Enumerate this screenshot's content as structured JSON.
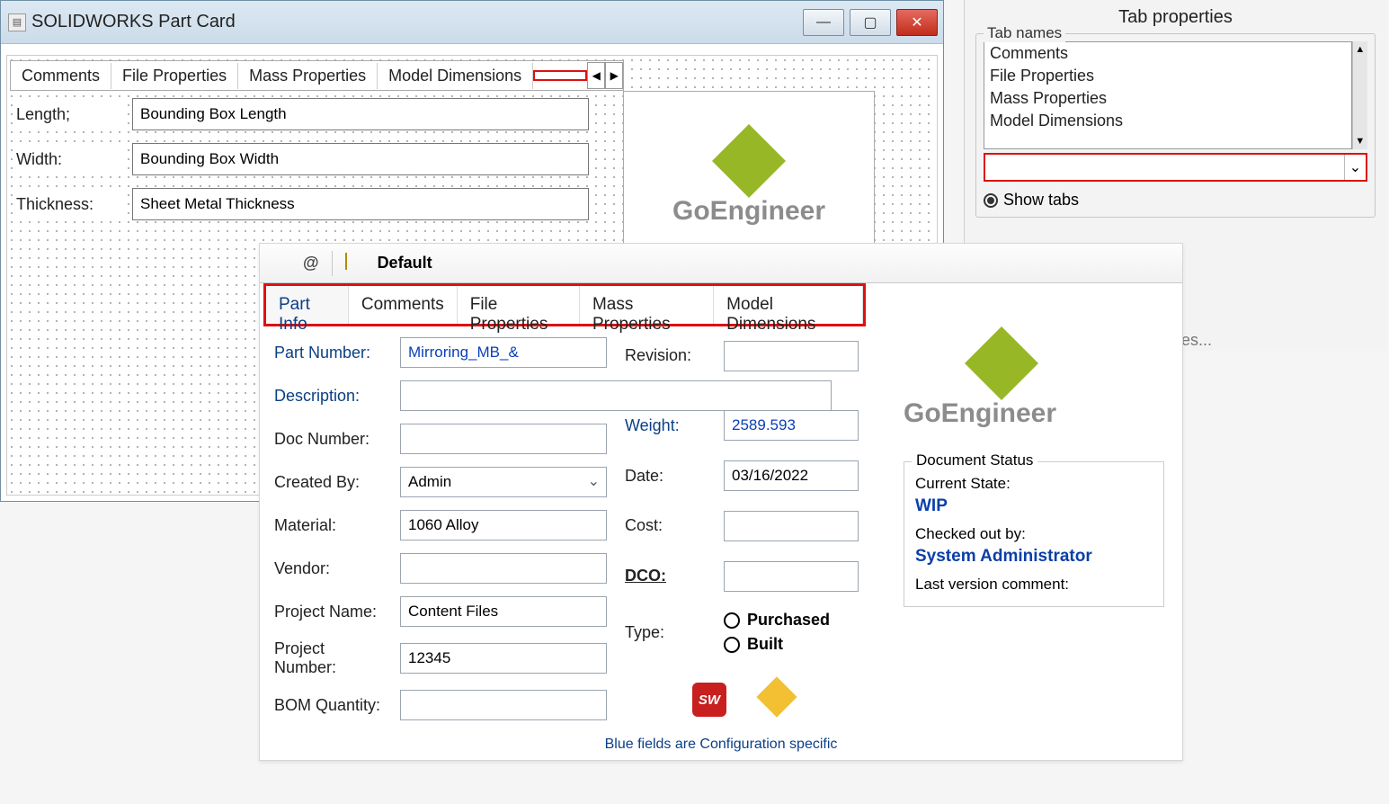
{
  "editor": {
    "title": "SOLIDWORKS Part Card",
    "tabs": [
      "Comments",
      "File Properties",
      "Mass Properties",
      "Model Dimensions"
    ],
    "dim_rows": [
      {
        "label": "Length;",
        "value": "Bounding Box Length"
      },
      {
        "label": "Width:",
        "value": "Bounding Box Width"
      },
      {
        "label": "Thickness:",
        "value": "Sheet Metal Thickness"
      }
    ],
    "logo_text": "GoEngineer"
  },
  "right_panel": {
    "heading": "Tab properties",
    "group_label": "Tab names",
    "tab_names": [
      "Comments",
      "File Properties",
      "Mass Properties",
      "Model Dimensions"
    ],
    "show_tabs_label": "Show tabs",
    "hint_fragment": "les..."
  },
  "card": {
    "upper_default": "Default",
    "tabs2": [
      "Part Info",
      "Comments",
      "File Properties",
      "Mass Properties",
      "Model Dimensions"
    ],
    "fields": {
      "part_number_label": "Part Number:",
      "part_number_value": "Mirroring_MB_&",
      "revision_label": "Revision:",
      "revision_value": "",
      "description_label": "Description:",
      "description_value": "",
      "doc_number_label": "Doc Number:",
      "doc_number_value": "",
      "weight_label": "Weight:",
      "weight_value": "2589.593",
      "created_by_label": "Created By:",
      "created_by_value": "Admin",
      "date_label": "Date:",
      "date_value": "03/16/2022",
      "material_label": "Material:",
      "material_value": "1060 Alloy",
      "cost_label": "Cost:",
      "cost_value": "",
      "vendor_label": "Vendor:",
      "vendor_value": "",
      "dco_label": "DCO:",
      "dco_value": "",
      "project_name_label": "Project Name:",
      "project_name_value": "Content Files",
      "type_label": "Type:",
      "type_opt1": "Purchased",
      "type_opt2": "Built",
      "project_number_label": "Project Number:",
      "project_number_value": "12345",
      "bom_qty_label": "BOM Quantity:",
      "bom_qty_value": ""
    },
    "logo_text": "GoEngineer",
    "doc_status": {
      "legend": "Document Status",
      "current_state_label": "Current State:",
      "current_state_value": "WIP",
      "checked_out_label": "Checked out by:",
      "checked_out_value": "System Administrator",
      "last_comment_label": "Last version comment:"
    },
    "footnote": "Blue fields are Configuration specific"
  }
}
